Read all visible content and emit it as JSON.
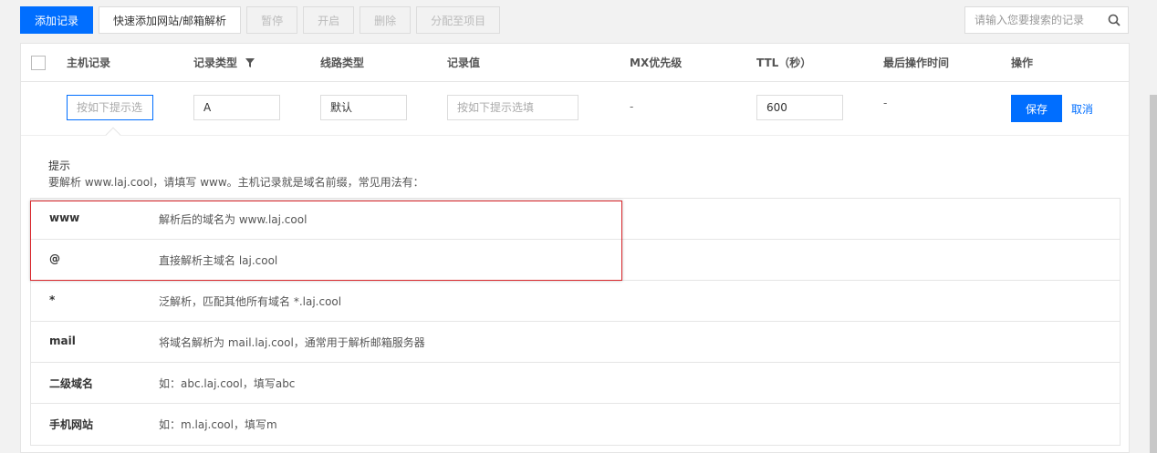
{
  "toolbar": {
    "add_record": "添加记录",
    "quick_add": "快速添加网站/邮箱解析",
    "pause": "暂停",
    "enable": "开启",
    "delete": "删除",
    "assign_project": "分配至项目"
  },
  "search": {
    "placeholder": "请输入您要搜索的记录",
    "icon": "search-icon"
  },
  "table": {
    "headers": {
      "host": "主机记录",
      "type": "记录类型",
      "line": "线路类型",
      "value": "记录值",
      "mx": "MX优先级",
      "ttl": "TTL（秒）",
      "last_op": "最后操作时间",
      "action": "操作"
    }
  },
  "edit_row": {
    "host_placeholder": "按如下提示选",
    "type_value": "A",
    "line_value": "默认",
    "value_placeholder": "按如下提示选填",
    "mx_value": "-",
    "ttl_value": "600",
    "last_op_value": "-",
    "save": "保存",
    "cancel": "取消"
  },
  "tip": {
    "title": "提示",
    "desc": "要解析 www.laj.cool，请填写 www。主机记录就是域名前缀，常见用法有：",
    "rows": [
      {
        "key": "www",
        "val": "解析后的域名为 www.laj.cool"
      },
      {
        "key": "@",
        "val": "直接解析主域名 laj.cool"
      },
      {
        "key": "*",
        "val": "泛解析，匹配其他所有域名 *.laj.cool"
      },
      {
        "key": "mail",
        "val": "将域名解析为 mail.laj.cool，通常用于解析邮箱服务器"
      },
      {
        "key": "二级域名",
        "val": "如：abc.laj.cool，填写abc"
      },
      {
        "key": "手机网站",
        "val": "如：m.laj.cool，填写m"
      }
    ]
  },
  "colors": {
    "primary": "#006eff",
    "highlight": "#d9252a"
  }
}
